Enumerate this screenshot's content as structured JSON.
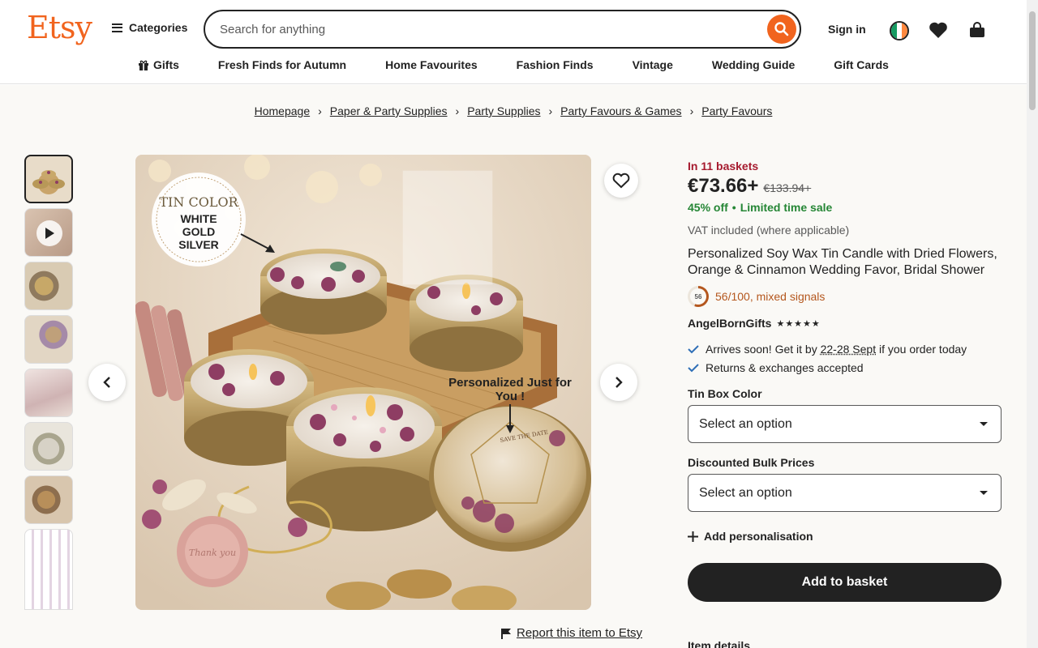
{
  "header": {
    "logo": "Etsy",
    "categories_label": "Categories",
    "search_placeholder": "Search for anything",
    "signin_label": "Sign in"
  },
  "subnav": {
    "items": [
      "Gifts",
      "Fresh Finds for Autumn",
      "Home Favourites",
      "Fashion Finds",
      "Vintage",
      "Wedding Guide",
      "Gift Cards"
    ]
  },
  "breadcrumb": [
    "Homepage",
    "Paper & Party Supplies",
    "Party Supplies",
    "Party Favours & Games",
    "Party Favours"
  ],
  "listing": {
    "baskets": "In 11 baskets",
    "price": "€73.66+",
    "old_price": "€133.94+",
    "discount": "45% off",
    "sale_label": "Limited time sale",
    "vat": "VAT included (where applicable)",
    "title": "Personalized Soy Wax Tin Candle with Dried Flowers, Orange & Cinnamon Wedding Favor, Bridal Shower",
    "score_badge": "56",
    "score_text": "56/100, mixed signals",
    "shop_name": "AngelBornGifts",
    "stars": "★★★★★",
    "arrival_prefix": "Arrives soon! Get it by ",
    "arrival_dates": "22-28 Sept",
    "arrival_suffix": " if you order today",
    "returns": "Returns & exchanges accepted",
    "option1_label": "Tin Box Color",
    "option1_value": "Select an option",
    "option2_label": "Discounted Bulk Prices",
    "option2_value": "Select an option",
    "personalisation": "Add personalisation",
    "add_to_basket": "Add to basket",
    "item_details": "Item details",
    "report": "Report this item to Etsy"
  },
  "photo": {
    "badge_line1": "TIN COLOR",
    "badge_line2": "WHITE",
    "badge_line3": "GOLD",
    "badge_line4": "SILVER",
    "caption": "Personalized Just for You !",
    "lid_text": "SAVE THE DATE"
  },
  "colors": {
    "brand": "#f1641e",
    "baskets": "#a61a2e",
    "sale": "#258635",
    "score": "#b4571e"
  }
}
